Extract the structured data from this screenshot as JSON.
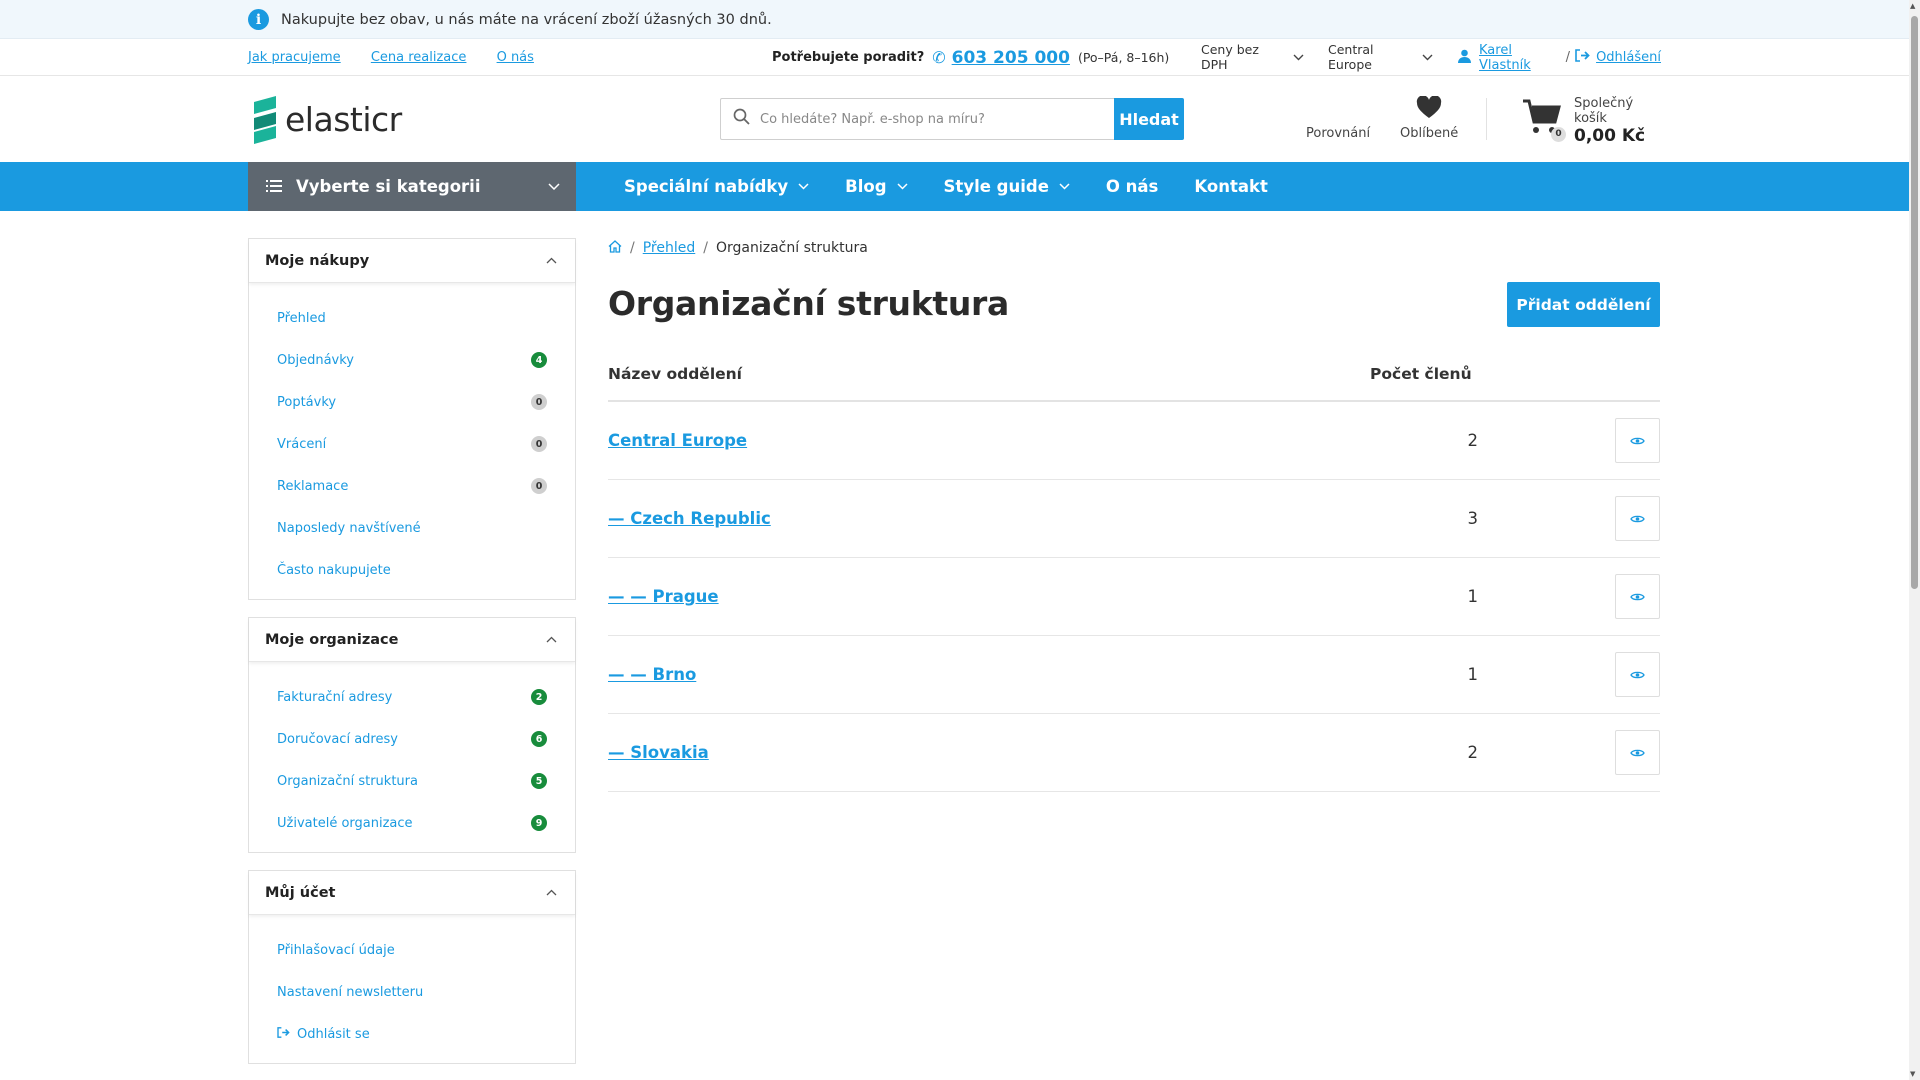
{
  "info_bar": {
    "text": "Nakupujte bez obav, u nás máte na vrácení zboží úžasných 30 dnů."
  },
  "top_links": [
    "Jak pracujeme",
    "Cena realizace",
    "O nás"
  ],
  "contact": {
    "question": "Potřebujete poradit?",
    "phone": "603 205 000",
    "hours": "(Po–Pá, 8–16h)"
  },
  "price_select": {
    "value_line1": "Ceny bez",
    "value_line2": "DPH"
  },
  "region_select": {
    "value_line1": "Central",
    "value_line2": "Europe"
  },
  "user": {
    "name": "Karel Vlastník",
    "separator": "/",
    "logout": "Odhlášení"
  },
  "logo": {
    "text": "elasticr"
  },
  "search": {
    "placeholder": "Co hledáte? Např. e-shop na míru?",
    "button": "Hledat"
  },
  "header": {
    "compare": "Porovnání",
    "favorites": "Oblíbené",
    "cart_label": "Společný košík",
    "cart_value": "0,00 Kč",
    "cart_count": "0"
  },
  "nav": {
    "categories": "Vyberte si kategorii",
    "items": [
      "Speciální nabídky",
      "Blog",
      "Style guide",
      "O nás",
      "Kontakt"
    ]
  },
  "sidebar": {
    "sections": [
      {
        "title": "Moje nákupy",
        "items": [
          {
            "label": "Přehled",
            "badge": ""
          },
          {
            "label": "Objednávky",
            "badge": "4"
          },
          {
            "label": "Poptávky",
            "badge": "0"
          },
          {
            "label": "Vrácení",
            "badge": "0"
          },
          {
            "label": "Reklamace",
            "badge": "0"
          },
          {
            "label": "Naposledy navštívené",
            "badge": ""
          },
          {
            "label": "Často nakupujete",
            "badge": ""
          }
        ]
      },
      {
        "title": "Moje organizace",
        "items": [
          {
            "label": "Fakturační adresy",
            "badge": "2"
          },
          {
            "label": "Doručovací adresy",
            "badge": "6"
          },
          {
            "label": "Organizační struktura",
            "badge": "5"
          },
          {
            "label": "Uživatelé organizace",
            "badge": "9"
          }
        ]
      },
      {
        "title": "Můj účet",
        "items": [
          {
            "label": "Přihlašovací údaje",
            "badge": ""
          },
          {
            "label": "Nastavení newsletteru",
            "badge": ""
          },
          {
            "label": "Odhlásit se",
            "badge": ""
          }
        ]
      }
    ]
  },
  "breadcrumb": {
    "parent": "Přehled",
    "current": "Organizační struktura"
  },
  "page": {
    "title": "Organizační struktura",
    "add_button": "Přidat oddělení"
  },
  "table": {
    "headers": {
      "name": "Název oddělení",
      "members": "Počet členů"
    },
    "rows": [
      {
        "name": "Central Europe",
        "members": "2"
      },
      {
        "name": "— Czech Republic",
        "members": "3"
      },
      {
        "name": "— — Prague",
        "members": "1"
      },
      {
        "name": "— — Brno",
        "members": "1"
      },
      {
        "name": "— Slovakia",
        "members": "2"
      }
    ]
  },
  "colors": {
    "accent": "#1a9ae0",
    "badge_green": "#188c3c",
    "category_bg": "#5e6770",
    "logo": "#1bb39a"
  }
}
